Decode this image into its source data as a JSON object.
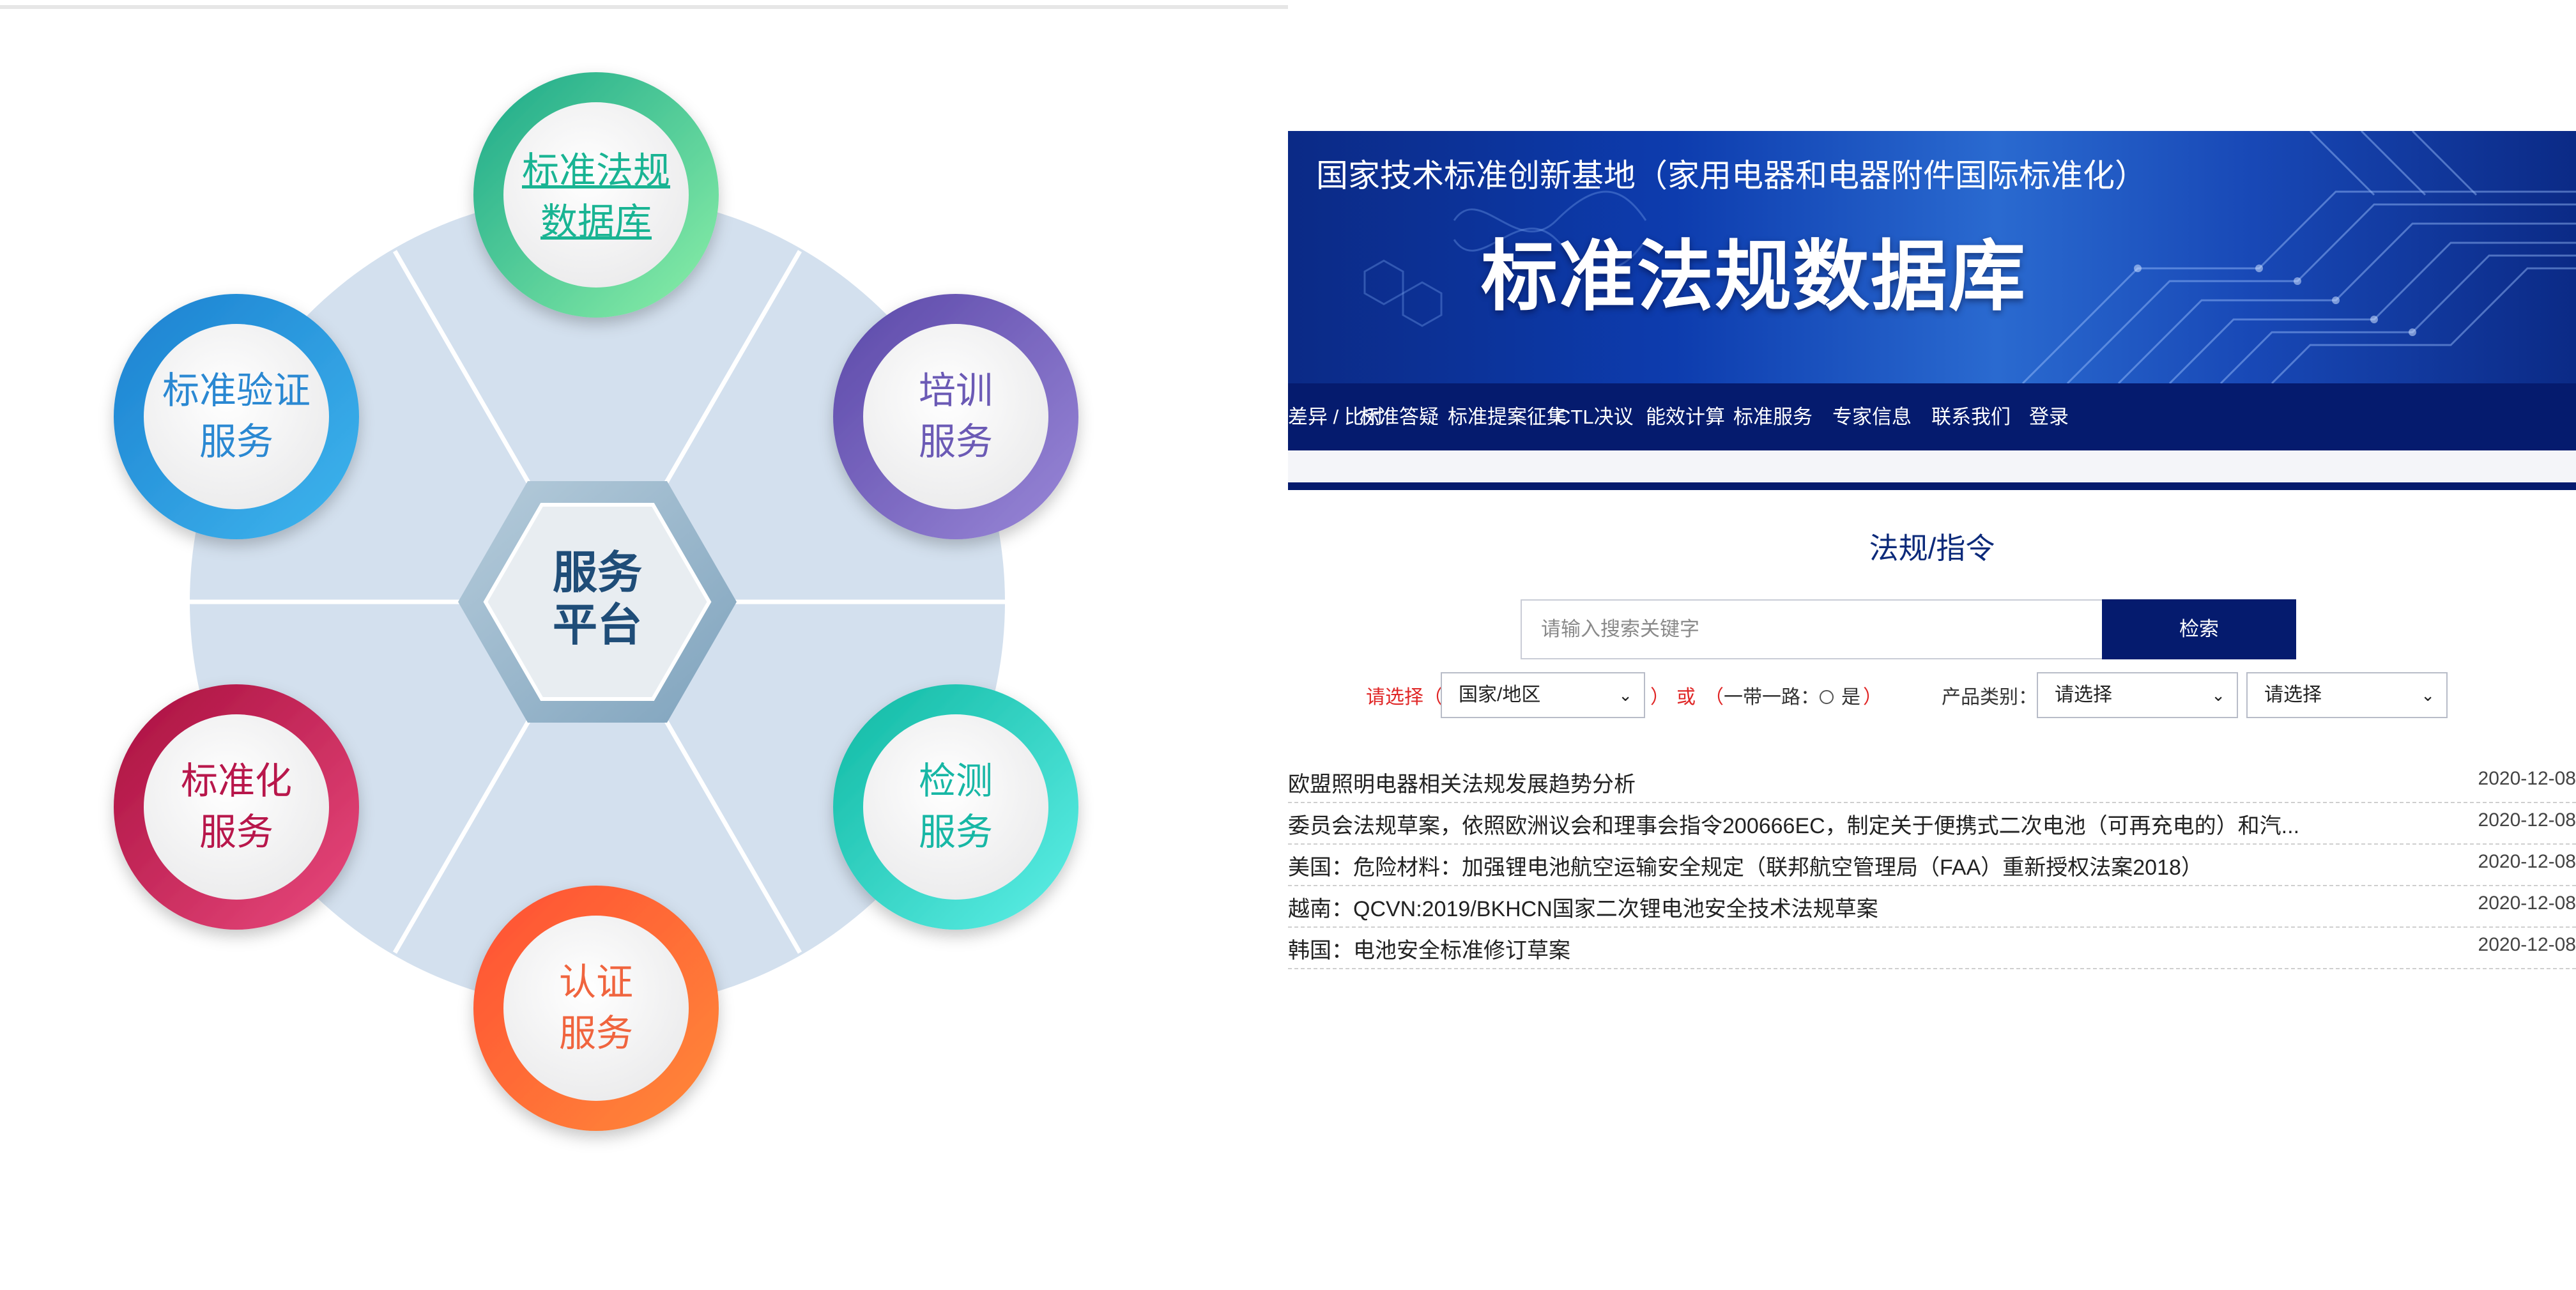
{
  "service_wheel": {
    "center": {
      "line1": "服务",
      "line2": "平台"
    },
    "items": [
      {
        "line1": "标准法规",
        "line2": "数据库",
        "color": "#1fb89a",
        "active": true
      },
      {
        "line1": "培训",
        "line2": "服务",
        "color": "#6a55b4"
      },
      {
        "line1": "检测",
        "line2": "服务",
        "color": "#19bfae"
      },
      {
        "line1": "认证",
        "line2": "服务",
        "color": "#f4633a"
      },
      {
        "line1": "标准化",
        "line2": "服务",
        "color": "#c0184f"
      },
      {
        "line1": "标准验证",
        "line2": "服务",
        "color": "#1e8fd8"
      }
    ]
  },
  "site": {
    "banner": {
      "subtitle": "国家技术标准创新基地（家用电器和电器附件国际标准化）",
      "title": "标准法规数据库"
    },
    "nav": [
      "差异 / 比对",
      "标准答疑",
      "标准提案征集",
      "CTL决议",
      "能效计算",
      "标准服务",
      "专家信息",
      "联系我们",
      "登录"
    ],
    "section_title": "法规/指令",
    "search": {
      "placeholder": "请输入搜索关键字",
      "button": "检索"
    },
    "filters": {
      "prompt_open": "请选择（",
      "country_value": "国家/地区",
      "prompt_close": "）",
      "or_label": "或",
      "belt_road_open": "（",
      "belt_road_label": "一带一路：",
      "belt_road_yes": "是",
      "belt_road_close": "）",
      "product_label": "产品类别：",
      "product_value": "请选择",
      "sub_value": "请选择"
    },
    "news": [
      {
        "title": "欧盟照明电器相关法规发展趋势分析",
        "date": "2020-12-08"
      },
      {
        "title": "委员会法规草案，依照欧洲议会和理事会指令200666EC，制定关于便携式二次电池（可再充电的）和汽...",
        "date": "2020-12-08"
      },
      {
        "title": "美国：危险材料：加强锂电池航空运输安全规定（联邦航空管理局（FAA）重新授权法案2018）",
        "date": "2020-12-08"
      },
      {
        "title": "越南：QCVN:2019/BKHCN国家二次锂电池安全技术法规草案",
        "date": "2020-12-08"
      },
      {
        "title": "韩国：电池安全标准修订草案",
        "date": "2020-12-08"
      }
    ]
  }
}
